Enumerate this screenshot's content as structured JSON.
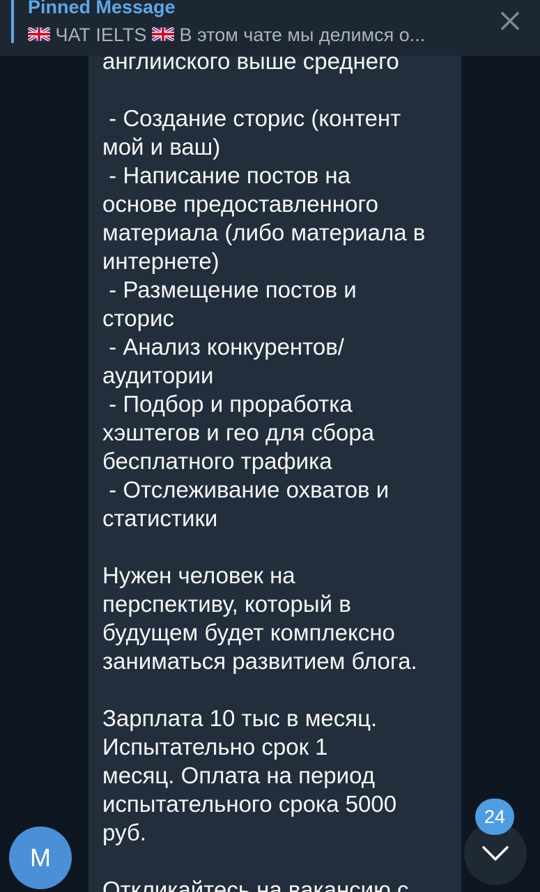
{
  "pinned": {
    "title": "Pinned Message",
    "chat_name": "ЧАТ IELTS",
    "preview": "В этом чате мы делимся о..."
  },
  "message": {
    "text": "английского выше среднего\n\n - Создание сторис (контент\nмой и ваш)\n - Написание постов на\nоснове предоставленного\nматериала (либо материала в\nинтернете)\n - Размещение постов и\nсторис\n - Анализ конкурентов/\nаудитории\n - Подбор и проработка\nхэштегов и гео для сбора\nбесплатного трафика\n - Отслеживание охватов и\nстатистики\n\nНужен человек на\nперспективу, который в\nбудущем будет комплексно\nзаниматься развитием блога.\n\nЗарплата 10 тыс в месяц.\nИспытательно срок 1\nмесяц. Оплата на период\nиспытательного срока 5000\nруб.\n\nОткликайтесь на вакансию с"
  },
  "avatar": {
    "initial": "M"
  },
  "scroll": {
    "unread_count": "24"
  },
  "icons": {
    "flag": "uk-flag-icon",
    "close": "close-icon",
    "scroll_down": "chevron-down-icon"
  },
  "colors": {
    "background": "#0e1621",
    "bubble": "#222e3b",
    "accent": "#5fa8e6",
    "avatar": "#4a90d6"
  }
}
